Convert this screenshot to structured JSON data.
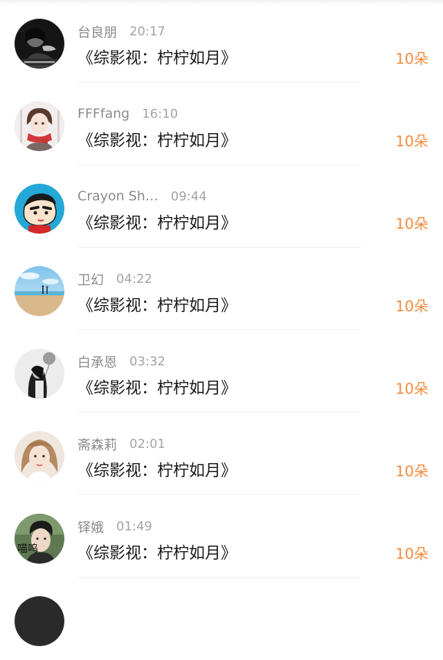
{
  "rows": [
    {
      "name": "台良朋",
      "time": "20:17",
      "message": "《综影视：柠柠如月》",
      "gift": "10朵",
      "avatar": "avatar-girl-dark"
    },
    {
      "name": "FFFfang",
      "time": "16:10",
      "message": "《综影视：柠柠如月》",
      "gift": "10朵",
      "avatar": "avatar-anime-girl-red-scarf"
    },
    {
      "name": "Crayon Sh…",
      "time": "09:44",
      "message": "《综影视：柠柠如月》",
      "gift": "10朵",
      "avatar": "avatar-crayon-shinchan"
    },
    {
      "name": "卫幻",
      "time": "04:22",
      "message": "《综影视：柠柠如月》",
      "gift": "10朵",
      "avatar": "avatar-beach-sky"
    },
    {
      "name": "白承恩",
      "time": "03:32",
      "message": "《综影视：柠柠如月》",
      "gift": "10朵",
      "avatar": "avatar-girl-balloon-bw"
    },
    {
      "name": "斋森莉",
      "time": "02:01",
      "message": "《综影视：柠柠如月》",
      "gift": "10朵",
      "avatar": "avatar-girl-portrait"
    },
    {
      "name": "铎娥",
      "time": "01:49",
      "message": "《综影视：柠柠如月》",
      "gift": "10朵",
      "avatar": "avatar-boy-miaowu",
      "avatar_caption": "喵呜"
    }
  ],
  "colors": {
    "name": "#8a8a8a",
    "time": "#a3a3a3",
    "message": "#1a1a1a",
    "gift": "#f58a3c",
    "divider": "#eeeeee"
  }
}
